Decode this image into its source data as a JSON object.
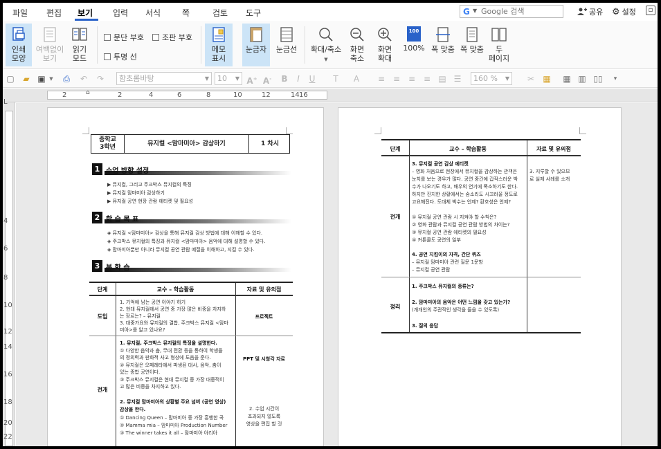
{
  "menu": {
    "items": [
      "파일",
      "편집",
      "보기",
      "입력",
      "서식",
      "쪽",
      "검토",
      "도구"
    ],
    "active": "보기"
  },
  "search": {
    "brand": "G",
    "placeholder": "Google 검색"
  },
  "topright": {
    "share": "공유",
    "settings": "설정"
  },
  "ribbon": {
    "print_layout": "인쇄\n모양",
    "no_margin": "여백없이\n보기",
    "read_mode": "읽기\n모드",
    "para_mark": "문단 부호",
    "format_mark": "조판 부호",
    "transparent_line": "투명 선",
    "memo": "메모\n표시",
    "ruler": "눈금자",
    "grid": "눈금선",
    "zoom": "확대/축소",
    "zoom_out": "화면\n축소",
    "zoom_in": "화면\n확대",
    "hundred": "100%",
    "hundred_icon": "100",
    "fit_width": "폭 맞춤",
    "fit_page": "쪽 맞춤",
    "two_page": "두\n페이지"
  },
  "toolbar": {
    "font": "함초롬바탕",
    "size": "10",
    "zoom": "160 %"
  },
  "ruler": {
    "h": [
      "2",
      "2",
      "4",
      "6",
      "8",
      "10",
      "12",
      "14",
      "16"
    ],
    "v": [
      "L",
      "4",
      "6",
      "8",
      "10",
      "12",
      "14",
      "16",
      "18",
      "20",
      "22"
    ]
  },
  "page1": {
    "header": {
      "grade": "중학교\n3학년",
      "title": "뮤지컬 <맘마미아> 감상하기",
      "period": "1 차시"
    },
    "sec1": {
      "num": "1",
      "title": "수업 방향 설정"
    },
    "sec1_items": [
      "▶ 뮤지컬, 그리고 주크박스 뮤지컬의 특징",
      "▶ 뮤지컬 맘마미아 감상하기",
      "▶ 뮤지컬 공연 현장 관람 에티켓 및 필요성"
    ],
    "sec2": {
      "num": "2",
      "title": "학 습 목 표"
    },
    "sec2_items": [
      "◈ 뮤지컬 <맘마미아> 감상을 통해 뮤지컬 감상 방법에 대해 이해할 수 있다.",
      "◈ 주크박스 뮤지컬의 특징과 뮤지컬 <맘마미아> 음악에 대해 설명할 수 있다.",
      "◈ 맘마미아뿐만 아니라 뮤지컬 공연 관람 예절을 이해하고, 지킬 수 있다."
    ],
    "sec3": {
      "num": "3",
      "title": "본 학 습"
    },
    "table": {
      "headers": [
        "단계",
        "교수 – 학습활동",
        "자료 및 유의점"
      ],
      "intro_stage": "도입",
      "intro_lines": [
        "1. 기억에 남는 공연 이야기 하기",
        "2. 현대 뮤지컬에서 공연 중 가장 많은 비중을 차지하",
        "   는 장르는? – 뮤지컬",
        "3. 대중가요와 뮤지컬의 결합, 주크박스 뮤지컬 <맘마",
        "   미아>를 알고 있나요?"
      ],
      "intro_note": "프로젝트",
      "dev_stage": "전개",
      "dev_lines": [
        "1. 뮤지컬, 주크박스 뮤지컬의 특징을 설명한다.",
        "① 다양한 음악과 춤, 무대 전환 등을 통하여 학생들",
        "   의 정의력과 판화적 사고 형상에 도움을 준다.",
        "② 뮤지컬은 오페레타에서 파생된 대사, 음악, 춤이",
        "   있는 종합 공연이다.",
        "③ 주크박스 뮤지컬은 현대 뮤지컬 중 가장 대중적이",
        "   고 많은 비중을 차지하고 있다.",
        "",
        "2. 뮤지컬 맘마미아의 상황별 주요 넘버 (공연 영상)",
        "   감상을 한다.",
        "① Dancing Queen – 맘마미아 중 가장 흥행한 곡",
        "② Mamma mia – 맘마미아 Production Number",
        "③ The winner takes it all – 맘마미아 아리아"
      ],
      "dev_note1": "PPT 및 시청각 자료",
      "dev_note2": [
        "2. 수업 시간이",
        "초과되지 않도록",
        "영상을 편집 할 것"
      ]
    }
  },
  "page2": {
    "headers": [
      "단계",
      "교수 – 학습활동",
      "자료 및 유의점"
    ],
    "dev_stage": "전개",
    "dev_lines": [
      "3. 뮤지컬 공연 감상 에티켓",
      "– 영화 처음으로 현장에서 뮤지컬을 감상하는 관객은",
      "눈치를 보는 경우가 많다. 공연 중간에 갑작스러운 박",
      "수가 나오기도 하고, 배우의 연기에 폭소하기도 한다.",
      "하지만 진지한 상황에서는 숨소리도 시끄러울 정도로",
      "고요해진다. 도대체 박수는 언제? 환호성은 언제?",
      "",
      "① 뮤지컬 공연 관람 시 지켜야 할 수칙은?",
      "② 영화 관람과 뮤지컬 공연 관람 방법의 차이는?",
      "③ 뮤지컬 공연 관람 에티켓의 필요성",
      "④ 커튼콜도 공연의 일부",
      "",
      "4. 공연 지킴이의 자격, 간단 퀴즈",
      "– 뮤지컬 맘마미아 관련 질문 1문항",
      "– 뮤지컬 공연 관람"
    ],
    "dev_note": [
      "3. 지루할 수 있으므",
      "로 실제 사례를 소개"
    ],
    "wrap_stage": "정리",
    "wrap_lines": [
      "1. 주크박스 뮤지컬의 종류는?",
      "",
      "2. 맘마미아의 음악은 어떤 느낌을 갖고 있는가?",
      "   (개개인의 주관적인 생각을 들을 수 있도록)",
      "",
      "3. 질의 응답"
    ]
  }
}
